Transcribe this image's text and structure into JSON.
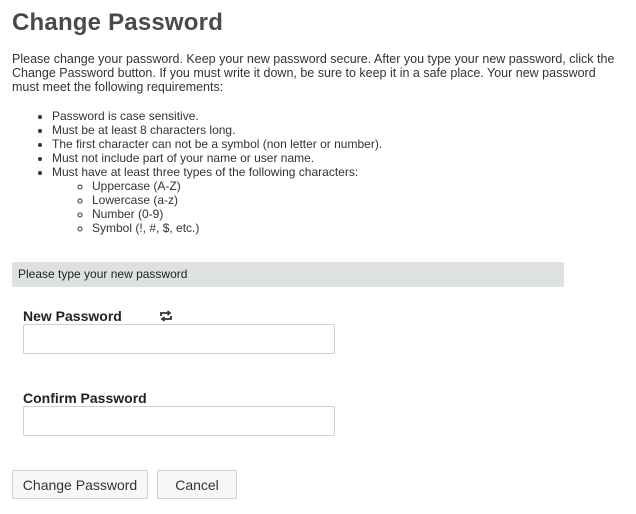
{
  "page": {
    "title": "Change Password",
    "intro": "Please change your password. Keep your new password secure. After you type your new password, click the Change Password button. If you must write it down, be sure to keep it in a safe place. Your new password must meet the following requirements:"
  },
  "requirements": {
    "items": [
      "Password is case sensitive.",
      "Must be at least 8 characters long.",
      "The first character can not be a symbol (non letter or number).",
      "Must not include part of your name or user name.",
      "Must have at least three types of the following characters:"
    ],
    "char_types": [
      "Uppercase (A-Z)",
      "Lowercase (a-z)",
      "Number (0-9)",
      "Symbol (!, #, $, etc.)"
    ]
  },
  "form": {
    "section_header": "Please type your new password",
    "new_password_label": "New Password",
    "new_password_value": "",
    "confirm_password_label": "Confirm Password",
    "confirm_password_value": "",
    "refresh_icon": "retweet-icon"
  },
  "buttons": {
    "change_label": "Change Password",
    "cancel_label": "Cancel"
  }
}
